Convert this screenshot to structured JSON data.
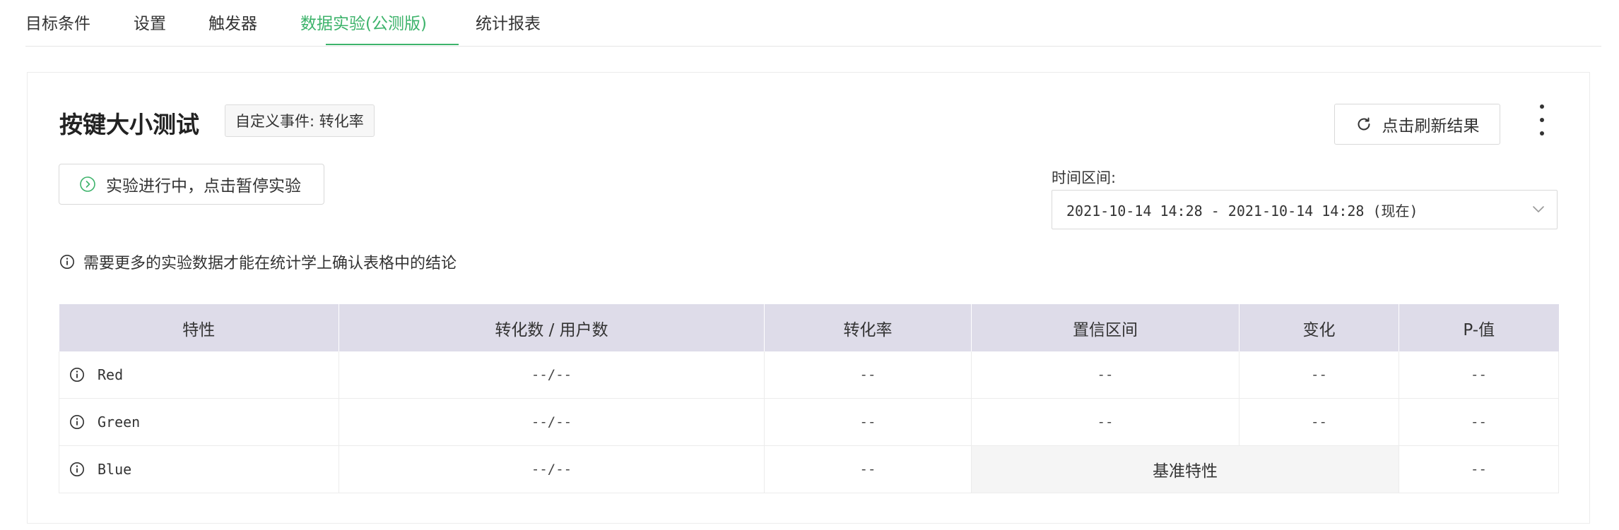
{
  "tabs": [
    {
      "label": "目标条件"
    },
    {
      "label": "设置"
    },
    {
      "label": "触发器"
    },
    {
      "label": "数据实验(公测版)",
      "active": true
    },
    {
      "label": "统计报表"
    }
  ],
  "experiment": {
    "title": "按键大小测试",
    "event_badge": "自定义事件: 转化率"
  },
  "actions": {
    "refresh_label": "点击刷新结果",
    "status_label": "实验进行中，点击暂停实验"
  },
  "time_range": {
    "label": "时间区间:",
    "value": "2021-10-14 14:28 - 2021-10-14 14:28 (现在)"
  },
  "notice": "需要更多的实验数据才能在统计学上确认表格中的结论",
  "table": {
    "headers": [
      "特性",
      "转化数 / 用户数",
      "转化率",
      "置信区间",
      "变化",
      "P-值"
    ],
    "rows": [
      {
        "feature": "Red",
        "conversions": "--/--",
        "rate": "--",
        "interval": "--",
        "change": "--",
        "p_value": "--"
      },
      {
        "feature": "Green",
        "conversions": "--/--",
        "rate": "--",
        "interval": "--",
        "change": "--",
        "p_value": "--"
      },
      {
        "feature": "Blue",
        "conversions": "--/--",
        "rate": "--",
        "baseline_label": "基准特性",
        "p_value": "--"
      }
    ]
  },
  "colors": {
    "accent": "#3db36b",
    "table_header_bg": "#dedce9",
    "baseline_bg": "#f5f5f5"
  },
  "icons": {
    "refresh": "refresh-icon",
    "status": "play-circle-icon",
    "more": "more-vertical-icon",
    "info": "info-icon",
    "dropdown": "chevron-down-icon"
  }
}
